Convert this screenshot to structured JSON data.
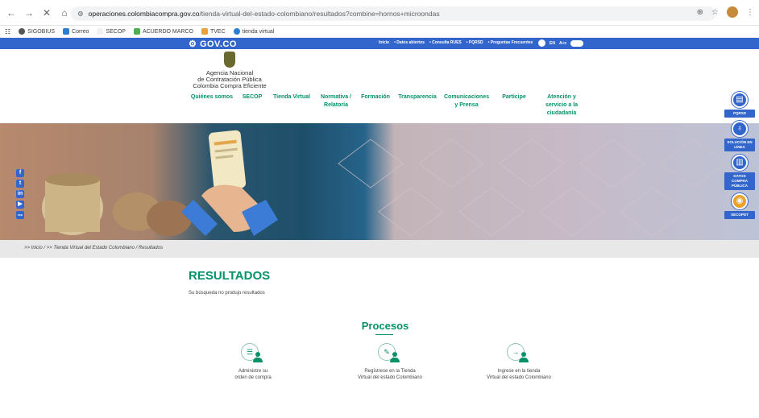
{
  "browser": {
    "url_host": "operaciones.colombiacompra.gov.co",
    "url_path": "/tienda-virtual-del-estado-colombiano/resultados?combine=hornos+microondas",
    "bookmarks": [
      "SIGOBIUS",
      "Correo",
      "SECOP",
      "ACUERDO MARCO",
      "TVEC",
      "tienda virtual"
    ]
  },
  "govbar": {
    "logo": "GOV.CO",
    "links": [
      "Inicio",
      "• Datos abiertos",
      "• Consulta RUES",
      "• PQRSD",
      "• Preguntas Frecuentes"
    ],
    "lang": "EN",
    "contrast": "A+c"
  },
  "agency": {
    "lines": [
      "Agencia Nacional",
      "de Contratación Pública",
      "Colombia Compra Eficiente"
    ]
  },
  "nav": {
    "items": [
      [
        "Quiénes somos"
      ],
      [
        "SECOP"
      ],
      [
        "Tienda Virtual"
      ],
      [
        "Normativa /",
        "Relatoría"
      ],
      [
        "Formación"
      ],
      [
        "Transparencia"
      ],
      [
        "Comunicaciones",
        "y Prensa"
      ],
      [
        "Participe"
      ],
      [
        "Atención y",
        "servicio a la",
        "ciudadanía"
      ]
    ]
  },
  "sidemenu": {
    "items": [
      "PQRSD",
      "SOLUCIÓN EN LÍNEA",
      "DATOS COMPRA PÚBLICA",
      "SECOPDT"
    ]
  },
  "social": [
    "f",
    "t",
    "in",
    "▶",
    "rss"
  ],
  "breadcrumb": ">> Inicio / >> Tienda Virtual del Estado Colombiano / Resultados",
  "results": {
    "title": "RESULTADOS",
    "subtitle": "Su búsqueda no produjo resultados"
  },
  "procesos": {
    "title": "Procesos",
    "items": [
      {
        "lines": [
          "Administre su",
          "orden de compra"
        ],
        "icon": "checklist-icon"
      },
      {
        "lines": [
          "Regístrese en la Tienda",
          "Virtual del estado Colombiano"
        ],
        "icon": "pencil-icon"
      },
      {
        "lines": [
          "Ingrese en la tienda",
          "Virtual del estado Colombiano"
        ],
        "icon": "arrow-right-icon"
      }
    ]
  }
}
